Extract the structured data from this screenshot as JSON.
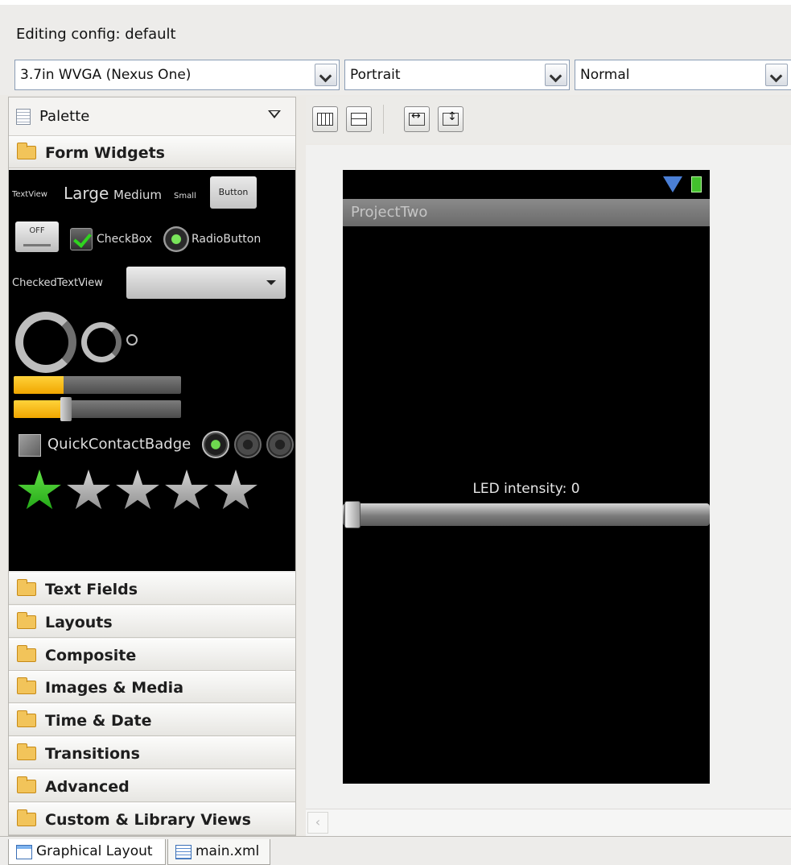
{
  "config": {
    "label": "Editing config:  default",
    "device": "3.7in WVGA (Nexus One)",
    "orientation": "Portrait",
    "theme": "Normal"
  },
  "palette": {
    "title": "Palette",
    "form_widgets": {
      "label": "Form Widgets",
      "textview": "TextView",
      "large": "Large",
      "medium": "Medium",
      "small": "Small",
      "button": "Button",
      "toggle": "OFF",
      "checkbox": "CheckBox",
      "radiobutton": "RadioButton",
      "checkedtextview": "CheckedTextView",
      "quickcontactbadge": "QuickContactBadge",
      "progress_fill": 0.3,
      "seek_fill": 0.3,
      "rating_value": 1,
      "rating_max": 5
    },
    "categories": [
      "Text Fields",
      "Layouts",
      "Composite",
      "Images & Media",
      "Time & Date",
      "Transitions",
      "Advanced",
      "Custom & Library Views"
    ]
  },
  "device": {
    "app_title": "ProjectTwo",
    "led_label": "LED intensity: 0",
    "seek_value": 0
  },
  "tabs": {
    "graphical": "Graphical Layout",
    "xml": "main.xml"
  },
  "colors": {
    "accent_yellow": "#f0a600",
    "star_green": "#1da312",
    "canvas": "#000000"
  }
}
